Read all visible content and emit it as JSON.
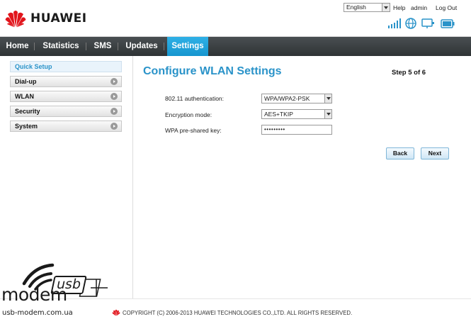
{
  "header": {
    "brand": "HUAWEI",
    "language": "English",
    "help_label": "Help",
    "user_label": "admin",
    "logout_label": "Log Out",
    "icons": [
      "signal-icon",
      "globe-icon",
      "monitor-icon",
      "battery-icon"
    ]
  },
  "nav": {
    "items": [
      {
        "label": "Home"
      },
      {
        "label": "Statistics"
      },
      {
        "label": "SMS"
      },
      {
        "label": "Updates"
      },
      {
        "label": "Settings",
        "active": true
      }
    ]
  },
  "sidebar": {
    "items": [
      {
        "label": "Quick Setup",
        "active": true
      },
      {
        "label": "Dial-up"
      },
      {
        "label": "WLAN"
      },
      {
        "label": "Security"
      },
      {
        "label": "System"
      }
    ]
  },
  "main": {
    "title": "Configure WLAN Settings",
    "step": "Step 5 of 6",
    "fields": {
      "auth_label": "802.11 authentication:",
      "auth_value": "WPA/WPA2-PSK",
      "enc_label": "Encryption mode:",
      "enc_value": "AES+TKIP",
      "psk_label": "WPA pre-shared key:",
      "psk_value": "•••••••••"
    },
    "back_label": "Back",
    "next_label": "Next"
  },
  "footer": {
    "copyright": "COPYRIGHT (C) 2006-2013 HUAWEI TECHNOLOGIES CO.,LTD. ALL RIGHTS RESERVED."
  },
  "watermark": {
    "usb": "usb",
    "modem": "modem",
    "url": "usb-modem.com.ua"
  },
  "colors": {
    "accent": "#2a93c9",
    "nav_bg": "#3a3f42",
    "brand_red": "#e1141b"
  }
}
